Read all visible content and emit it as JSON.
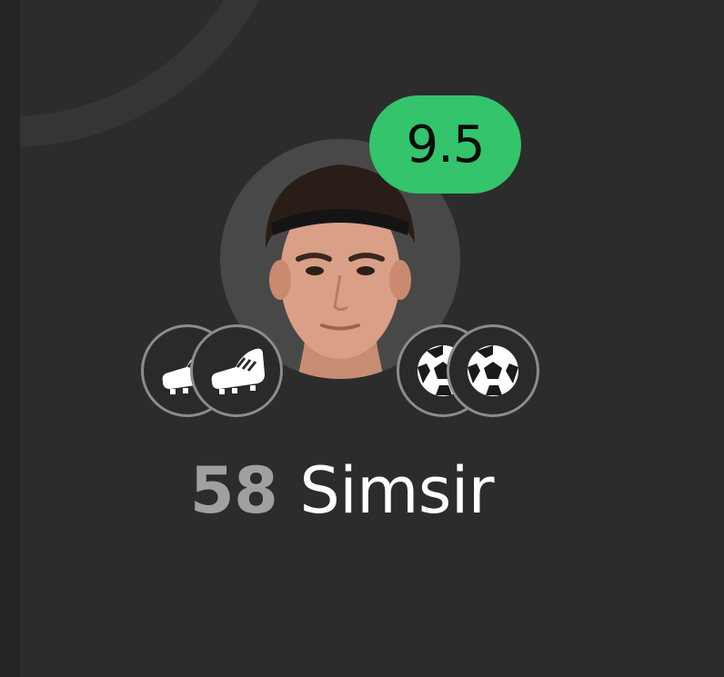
{
  "player": {
    "rating": "9.5",
    "shirt_number": "58",
    "name": "Simsir",
    "events": [
      {
        "type": "assist",
        "icon": "football-boot-icon"
      },
      {
        "type": "assist",
        "icon": "football-boot-icon"
      },
      {
        "type": "goal",
        "icon": "soccer-ball-icon"
      },
      {
        "type": "goal",
        "icon": "soccer-ball-icon"
      }
    ]
  },
  "colors": {
    "background": "#2c2c2c",
    "rating_badge": "#33c46c",
    "shirt_number": "#a0a0a0",
    "name": "#ffffff",
    "avatar_bg": "#484848"
  }
}
